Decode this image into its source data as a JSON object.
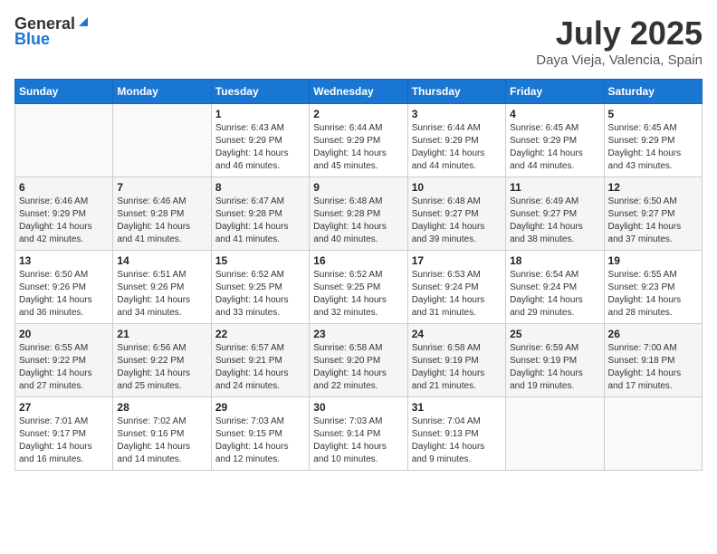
{
  "header": {
    "logo_general": "General",
    "logo_blue": "Blue",
    "month_year": "July 2025",
    "location": "Daya Vieja, Valencia, Spain"
  },
  "days_of_week": [
    "Sunday",
    "Monday",
    "Tuesday",
    "Wednesday",
    "Thursday",
    "Friday",
    "Saturday"
  ],
  "weeks": [
    [
      {
        "day": "",
        "sunrise": "",
        "sunset": "",
        "daylight": ""
      },
      {
        "day": "",
        "sunrise": "",
        "sunset": "",
        "daylight": ""
      },
      {
        "day": "1",
        "sunrise": "Sunrise: 6:43 AM",
        "sunset": "Sunset: 9:29 PM",
        "daylight": "Daylight: 14 hours and 46 minutes."
      },
      {
        "day": "2",
        "sunrise": "Sunrise: 6:44 AM",
        "sunset": "Sunset: 9:29 PM",
        "daylight": "Daylight: 14 hours and 45 minutes."
      },
      {
        "day": "3",
        "sunrise": "Sunrise: 6:44 AM",
        "sunset": "Sunset: 9:29 PM",
        "daylight": "Daylight: 14 hours and 44 minutes."
      },
      {
        "day": "4",
        "sunrise": "Sunrise: 6:45 AM",
        "sunset": "Sunset: 9:29 PM",
        "daylight": "Daylight: 14 hours and 44 minutes."
      },
      {
        "day": "5",
        "sunrise": "Sunrise: 6:45 AM",
        "sunset": "Sunset: 9:29 PM",
        "daylight": "Daylight: 14 hours and 43 minutes."
      }
    ],
    [
      {
        "day": "6",
        "sunrise": "Sunrise: 6:46 AM",
        "sunset": "Sunset: 9:29 PM",
        "daylight": "Daylight: 14 hours and 42 minutes."
      },
      {
        "day": "7",
        "sunrise": "Sunrise: 6:46 AM",
        "sunset": "Sunset: 9:28 PM",
        "daylight": "Daylight: 14 hours and 41 minutes."
      },
      {
        "day": "8",
        "sunrise": "Sunrise: 6:47 AM",
        "sunset": "Sunset: 9:28 PM",
        "daylight": "Daylight: 14 hours and 41 minutes."
      },
      {
        "day": "9",
        "sunrise": "Sunrise: 6:48 AM",
        "sunset": "Sunset: 9:28 PM",
        "daylight": "Daylight: 14 hours and 40 minutes."
      },
      {
        "day": "10",
        "sunrise": "Sunrise: 6:48 AM",
        "sunset": "Sunset: 9:27 PM",
        "daylight": "Daylight: 14 hours and 39 minutes."
      },
      {
        "day": "11",
        "sunrise": "Sunrise: 6:49 AM",
        "sunset": "Sunset: 9:27 PM",
        "daylight": "Daylight: 14 hours and 38 minutes."
      },
      {
        "day": "12",
        "sunrise": "Sunrise: 6:50 AM",
        "sunset": "Sunset: 9:27 PM",
        "daylight": "Daylight: 14 hours and 37 minutes."
      }
    ],
    [
      {
        "day": "13",
        "sunrise": "Sunrise: 6:50 AM",
        "sunset": "Sunset: 9:26 PM",
        "daylight": "Daylight: 14 hours and 36 minutes."
      },
      {
        "day": "14",
        "sunrise": "Sunrise: 6:51 AM",
        "sunset": "Sunset: 9:26 PM",
        "daylight": "Daylight: 14 hours and 34 minutes."
      },
      {
        "day": "15",
        "sunrise": "Sunrise: 6:52 AM",
        "sunset": "Sunset: 9:25 PM",
        "daylight": "Daylight: 14 hours and 33 minutes."
      },
      {
        "day": "16",
        "sunrise": "Sunrise: 6:52 AM",
        "sunset": "Sunset: 9:25 PM",
        "daylight": "Daylight: 14 hours and 32 minutes."
      },
      {
        "day": "17",
        "sunrise": "Sunrise: 6:53 AM",
        "sunset": "Sunset: 9:24 PM",
        "daylight": "Daylight: 14 hours and 31 minutes."
      },
      {
        "day": "18",
        "sunrise": "Sunrise: 6:54 AM",
        "sunset": "Sunset: 9:24 PM",
        "daylight": "Daylight: 14 hours and 29 minutes."
      },
      {
        "day": "19",
        "sunrise": "Sunrise: 6:55 AM",
        "sunset": "Sunset: 9:23 PM",
        "daylight": "Daylight: 14 hours and 28 minutes."
      }
    ],
    [
      {
        "day": "20",
        "sunrise": "Sunrise: 6:55 AM",
        "sunset": "Sunset: 9:22 PM",
        "daylight": "Daylight: 14 hours and 27 minutes."
      },
      {
        "day": "21",
        "sunrise": "Sunrise: 6:56 AM",
        "sunset": "Sunset: 9:22 PM",
        "daylight": "Daylight: 14 hours and 25 minutes."
      },
      {
        "day": "22",
        "sunrise": "Sunrise: 6:57 AM",
        "sunset": "Sunset: 9:21 PM",
        "daylight": "Daylight: 14 hours and 24 minutes."
      },
      {
        "day": "23",
        "sunrise": "Sunrise: 6:58 AM",
        "sunset": "Sunset: 9:20 PM",
        "daylight": "Daylight: 14 hours and 22 minutes."
      },
      {
        "day": "24",
        "sunrise": "Sunrise: 6:58 AM",
        "sunset": "Sunset: 9:19 PM",
        "daylight": "Daylight: 14 hours and 21 minutes."
      },
      {
        "day": "25",
        "sunrise": "Sunrise: 6:59 AM",
        "sunset": "Sunset: 9:19 PM",
        "daylight": "Daylight: 14 hours and 19 minutes."
      },
      {
        "day": "26",
        "sunrise": "Sunrise: 7:00 AM",
        "sunset": "Sunset: 9:18 PM",
        "daylight": "Daylight: 14 hours and 17 minutes."
      }
    ],
    [
      {
        "day": "27",
        "sunrise": "Sunrise: 7:01 AM",
        "sunset": "Sunset: 9:17 PM",
        "daylight": "Daylight: 14 hours and 16 minutes."
      },
      {
        "day": "28",
        "sunrise": "Sunrise: 7:02 AM",
        "sunset": "Sunset: 9:16 PM",
        "daylight": "Daylight: 14 hours and 14 minutes."
      },
      {
        "day": "29",
        "sunrise": "Sunrise: 7:03 AM",
        "sunset": "Sunset: 9:15 PM",
        "daylight": "Daylight: 14 hours and 12 minutes."
      },
      {
        "day": "30",
        "sunrise": "Sunrise: 7:03 AM",
        "sunset": "Sunset: 9:14 PM",
        "daylight": "Daylight: 14 hours and 10 minutes."
      },
      {
        "day": "31",
        "sunrise": "Sunrise: 7:04 AM",
        "sunset": "Sunset: 9:13 PM",
        "daylight": "Daylight: 14 hours and 9 minutes."
      },
      {
        "day": "",
        "sunrise": "",
        "sunset": "",
        "daylight": ""
      },
      {
        "day": "",
        "sunrise": "",
        "sunset": "",
        "daylight": ""
      }
    ]
  ]
}
